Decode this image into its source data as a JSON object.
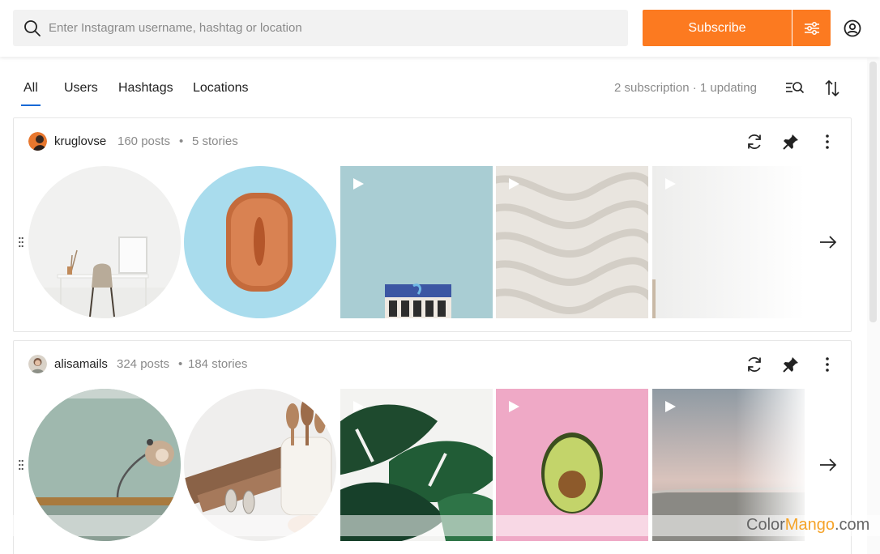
{
  "search": {
    "placeholder": "Enter Instagram username, hashtag or location",
    "icon": "search-icon"
  },
  "header": {
    "subscribe_label": "Subscribe",
    "filters_icon": "sliders-icon",
    "account_icon": "account-icon",
    "accent_color": "#fc7a20"
  },
  "tabs": {
    "items": [
      {
        "label": "All",
        "active": true
      },
      {
        "label": "Users",
        "active": false
      },
      {
        "label": "Hashtags",
        "active": false
      },
      {
        "label": "Locations",
        "active": false
      }
    ],
    "status": "2 subscription · 1 updating",
    "search_list_icon": "list-search-icon",
    "sort_icon": "sort-icon"
  },
  "feeds": [
    {
      "username": "kruglovse",
      "posts": "160 posts",
      "stories": "5 stories",
      "separator": "•",
      "actions": [
        "refresh-icon",
        "pin-icon",
        "more-icon"
      ],
      "items": [
        {
          "kind": "story",
          "scene": "white desk with chair"
        },
        {
          "kind": "story",
          "scene": "terracotta bowl on light blue"
        },
        {
          "kind": "video",
          "scene": "building against sky"
        },
        {
          "kind": "video",
          "scene": "sand ripples"
        },
        {
          "kind": "video",
          "scene": "white wall"
        }
      ]
    },
    {
      "username": "alisamails",
      "posts": "324 posts",
      "stories": "184 stories",
      "separator": "•",
      "actions": [
        "refresh-icon",
        "pin-icon",
        "more-icon"
      ],
      "items": [
        {
          "kind": "story",
          "scene": "lamp on mint wall"
        },
        {
          "kind": "story",
          "scene": "kitchen utensils in jar"
        },
        {
          "kind": "video",
          "scene": "monstera leaves"
        },
        {
          "kind": "video",
          "scene": "avocado half on pink"
        },
        {
          "kind": "video",
          "scene": "beach at sunset"
        }
      ]
    }
  ],
  "watermark": {
    "prefix": "Color",
    "mid": "Mango",
    "suffix": ".com"
  }
}
